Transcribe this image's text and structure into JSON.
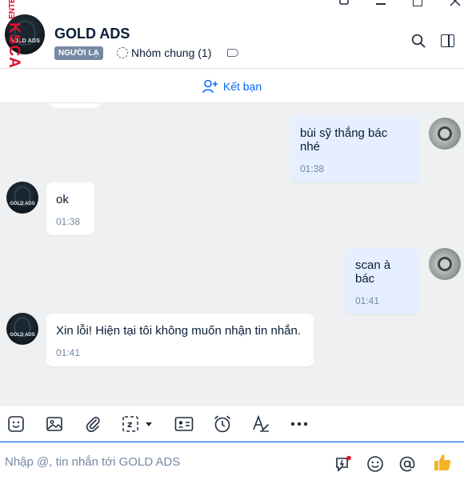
{
  "watermark": {
    "line1": "ENTER",
    "line2": "KSCAM.INFO"
  },
  "header": {
    "avatar_text": "GOLD ADS",
    "title": "GOLD ADS",
    "badge": "NGƯỜI LẠ",
    "group_label": "Nhóm chung (1)"
  },
  "friendbar": {
    "label": "Kết bạn"
  },
  "messages": [
    {
      "direction": "out",
      "text": "bùi sỹ thắng bác nhé",
      "time": "01:38"
    },
    {
      "direction": "in",
      "text": "ok",
      "time": "01:38"
    },
    {
      "direction": "out",
      "text": "scan à bác",
      "time": "01:41"
    },
    {
      "direction": "in",
      "text": "Xin lỗi! Hiện tại tôi không muốn nhận tin nhắn.",
      "time": "01:41"
    }
  ],
  "toolbar": {
    "icons": [
      "sticker-icon",
      "image-icon",
      "attachment-icon",
      "screenshot-icon",
      "contact-card-icon",
      "reminder-icon",
      "format-icon",
      "more-icon"
    ]
  },
  "input": {
    "placeholder": "Nhập @, tin nhắn tới GOLD ADS",
    "value": ""
  },
  "colors": {
    "accent": "#0068ff",
    "outgoing_bubble": "#e5efff",
    "chat_bg": "#eef0f1",
    "watermark": "#e0112b",
    "like": "#f5b324"
  }
}
